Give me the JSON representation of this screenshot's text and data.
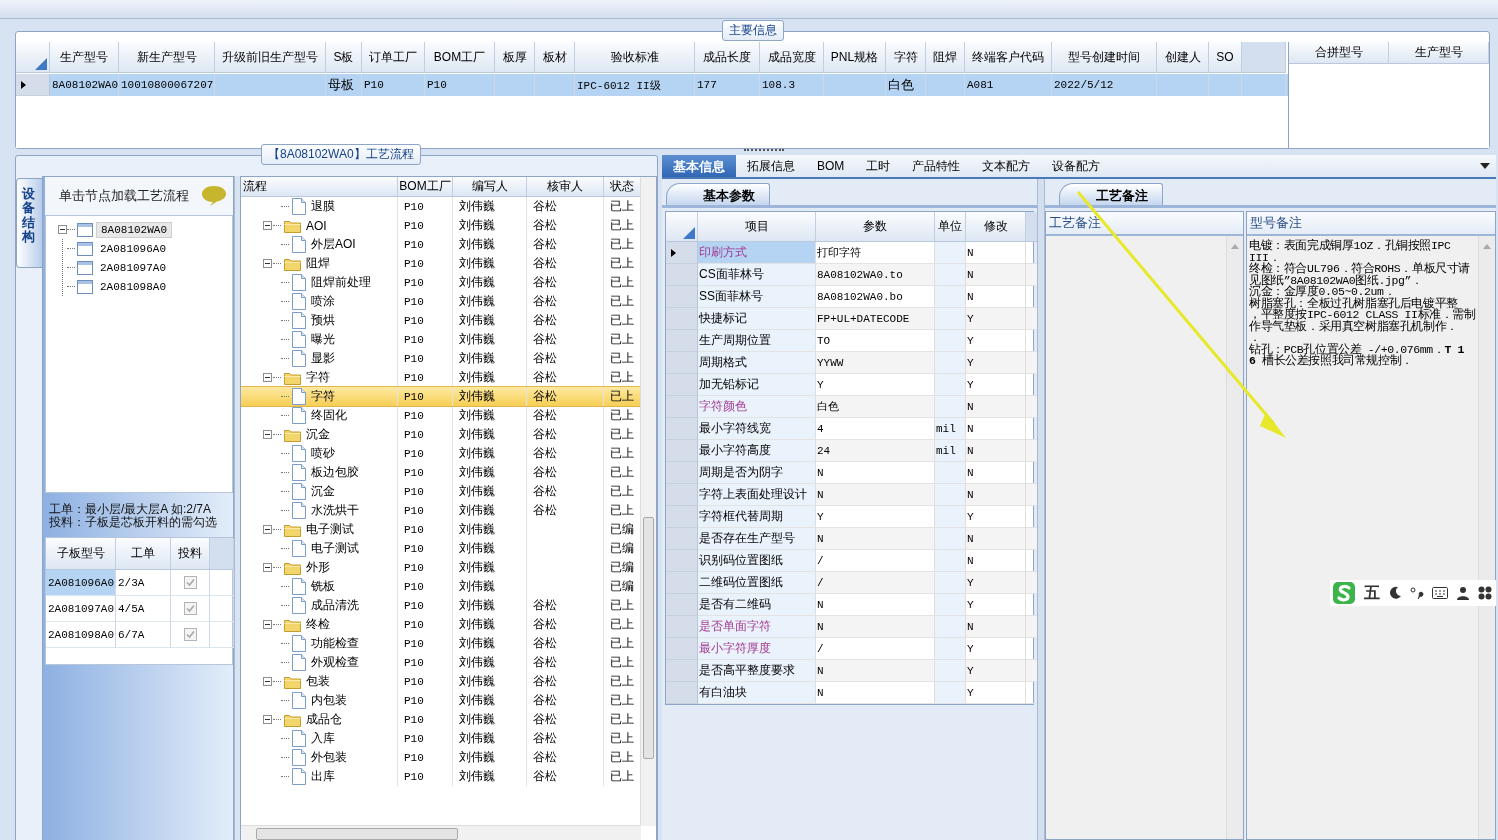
{
  "main_info": {
    "legend": "主要信息",
    "columns": [
      "生产型号",
      "新生产型号",
      "升级前旧生产型号",
      "S板",
      "订单工厂",
      "BOM工厂",
      "板厚",
      "板材",
      "验收标准",
      "成品长度",
      "成品宽度",
      "PNL规格",
      "字符",
      "阻焊",
      "终端客户代码",
      "型号创建时间",
      "创建人",
      "SO"
    ],
    "rows": [
      {
        "selected": true,
        "cells": [
          "8A08102WA0",
          "10010800067207",
          null,
          "母板",
          "P10",
          "P10",
          null,
          null,
          "IPC-6012 II级",
          "177",
          "108.3",
          null,
          "白色",
          null,
          "A081",
          "2022/5/12",
          null,
          null
        ]
      }
    ]
  },
  "merge_grid": {
    "columns": [
      "合拼型号",
      "生产型号"
    ]
  },
  "process_panel": {
    "legend": "【8A08102WA0】工艺流程",
    "side_tab": {
      "label": "设备结构",
      "selected": true
    },
    "structure": {
      "hint": "单击节点加载工艺流程",
      "tree": [
        {
          "label": "8A08102WA0",
          "expanded": true,
          "selected": true,
          "children": [
            {
              "label": "2A081096A0",
              "selected": false
            },
            {
              "label": "2A081097A0",
              "selected": false
            },
            {
              "label": "2A081098A0",
              "selected": false
            }
          ]
        }
      ]
    },
    "notes": [
      "工单：最小层/最大层A 如:2/7A",
      "投料：子板是芯板开料的需勾选"
    ],
    "sub_boards": {
      "columns": [
        "子板型号",
        "工单",
        "投料"
      ],
      "rows": [
        {
          "board": "2A081096A0",
          "order": "2/3A",
          "checked": true,
          "selected": true
        },
        {
          "board": "2A081097A0",
          "order": "4/5A",
          "checked": true,
          "selected": false
        },
        {
          "board": "2A081098A0",
          "order": "6/7A",
          "checked": true,
          "selected": false
        }
      ]
    },
    "flow": {
      "columns": [
        "流程",
        "BOM工厂",
        "编写人",
        "核审人",
        "状态"
      ],
      "rows": [
        {
          "name": "退膜",
          "factory": "P10",
          "writer": "刘伟巍",
          "reviewer": "谷松",
          "status": "已上",
          "selected": false
        },
        {
          "name": "AOI",
          "factory": "P10",
          "writer": "刘伟巍",
          "reviewer": "谷松",
          "status": "已上",
          "selected": false,
          "expanded": true,
          "children": [
            {
              "name": "外层AOI",
              "factory": "P10",
              "writer": "刘伟巍",
              "reviewer": "谷松",
              "status": "已上",
              "selected": false
            }
          ]
        },
        {
          "name": "阻焊",
          "factory": "P10",
          "writer": "刘伟巍",
          "reviewer": "谷松",
          "status": "已上",
          "selected": false,
          "expanded": true,
          "children": [
            {
              "name": "阻焊前处理",
              "factory": "P10",
              "writer": "刘伟巍",
              "reviewer": "谷松",
              "status": "已上",
              "selected": false
            },
            {
              "name": "喷涂",
              "factory": "P10",
              "writer": "刘伟巍",
              "reviewer": "谷松",
              "status": "已上",
              "selected": false
            },
            {
              "name": "预烘",
              "factory": "P10",
              "writer": "刘伟巍",
              "reviewer": "谷松",
              "status": "已上",
              "selected": false
            },
            {
              "name": "曝光",
              "factory": "P10",
              "writer": "刘伟巍",
              "reviewer": "谷松",
              "status": "已上",
              "selected": false
            },
            {
              "name": "显影",
              "factory": "P10",
              "writer": "刘伟巍",
              "reviewer": "谷松",
              "status": "已上",
              "selected": false
            }
          ]
        },
        {
          "name": "字符",
          "factory": "P10",
          "writer": "刘伟巍",
          "reviewer": "谷松",
          "status": "已上",
          "selected": false,
          "expanded": true,
          "children": [
            {
              "name": "字符",
              "factory": "P10",
              "writer": "刘伟巍",
              "reviewer": "谷松",
              "status": "已上",
              "selected": true
            },
            {
              "name": "终固化",
              "factory": "P10",
              "writer": "刘伟巍",
              "reviewer": "谷松",
              "status": "已上",
              "selected": false
            }
          ]
        },
        {
          "name": "沉金",
          "factory": "P10",
          "writer": "刘伟巍",
          "reviewer": "谷松",
          "status": "已上",
          "selected": false,
          "expanded": true,
          "children": [
            {
              "name": "喷砂",
              "factory": "P10",
              "writer": "刘伟巍",
              "reviewer": "谷松",
              "status": "已上",
              "selected": false
            },
            {
              "name": "板边包胶",
              "factory": "P10",
              "writer": "刘伟巍",
              "reviewer": "谷松",
              "status": "已上",
              "selected": false
            },
            {
              "name": "沉金",
              "factory": "P10",
              "writer": "刘伟巍",
              "reviewer": "谷松",
              "status": "已上",
              "selected": false
            },
            {
              "name": "水洗烘干",
              "factory": "P10",
              "writer": "刘伟巍",
              "reviewer": "谷松",
              "status": "已上",
              "selected": false
            }
          ]
        },
        {
          "name": "电子测试",
          "factory": "P10",
          "writer": "刘伟巍",
          "status": "已编",
          "selected": false,
          "expanded": true,
          "children": [
            {
              "name": "电子测试",
              "factory": "P10",
              "writer": "刘伟巍",
              "status": "已编",
              "selected": false
            }
          ]
        },
        {
          "name": "外形",
          "factory": "P10",
          "writer": "刘伟巍",
          "status": "已编",
          "selected": false,
          "expanded": true,
          "children": [
            {
              "name": "铣板",
              "factory": "P10",
              "writer": "刘伟巍",
              "status": "已编",
              "selected": false
            },
            {
              "name": "成品清洗",
              "factory": "P10",
              "writer": "刘伟巍",
              "reviewer": "谷松",
              "status": "已上",
              "selected": false
            }
          ]
        },
        {
          "name": "终检",
          "factory": "P10",
          "writer": "刘伟巍",
          "reviewer": "谷松",
          "status": "已上",
          "selected": false,
          "expanded": true,
          "children": [
            {
              "name": "功能检查",
              "factory": "P10",
              "writer": "刘伟巍",
              "reviewer": "谷松",
              "status": "已上",
              "selected": false
            },
            {
              "name": "外观检查",
              "factory": "P10",
              "writer": "刘伟巍",
              "reviewer": "谷松",
              "status": "已上",
              "selected": false
            }
          ]
        },
        {
          "name": "包装",
          "factory": "P10",
          "writer": "刘伟巍",
          "reviewer": "谷松",
          "status": "已上",
          "selected": false,
          "expanded": true,
          "children": [
            {
              "name": "内包装",
              "factory": "P10",
              "writer": "刘伟巍",
              "reviewer": "谷松",
              "status": "已上",
              "selected": false
            }
          ]
        },
        {
          "name": "成品仓",
          "factory": "P10",
          "writer": "刘伟巍",
          "reviewer": "谷松",
          "status": "已上",
          "selected": false,
          "expanded": true,
          "children": [
            {
              "name": "入库",
              "factory": "P10",
              "writer": "刘伟巍",
              "reviewer": "谷松",
              "status": "已上",
              "selected": false
            },
            {
              "name": "外包装",
              "factory": "P10",
              "writer": "刘伟巍",
              "reviewer": "谷松",
              "status": "已上",
              "selected": false
            },
            {
              "name": "出库",
              "factory": "P10",
              "writer": "刘伟巍",
              "reviewer": "谷松",
              "status": "已上",
              "selected": false
            }
          ]
        }
      ]
    }
  },
  "detail": {
    "tabs": [
      {
        "label": "基本信息",
        "selected": true
      },
      {
        "label": "拓展信息",
        "selected": false
      },
      {
        "label": "BOM",
        "selected": false
      },
      {
        "label": "工时",
        "selected": false
      },
      {
        "label": "产品特性",
        "selected": false
      },
      {
        "label": "文本配方",
        "selected": false
      },
      {
        "label": "设备配方",
        "selected": false
      }
    ],
    "basic": {
      "tab": {
        "label": "基本参数",
        "selected": true
      },
      "columns": [
        "项目",
        "参数",
        "单位",
        "修改"
      ],
      "rows": [
        {
          "item": "印刷方式",
          "value": "打印字符",
          "modified": "N",
          "highlighted": true,
          "selected": true
        },
        {
          "item": "CS面菲林号",
          "value": "8A08102WA0.to",
          "modified": "N",
          "highlighted": false,
          "selected": false
        },
        {
          "item": "SS面菲林号",
          "value": "8A08102WA0.bo",
          "modified": "N",
          "highlighted": false,
          "selected": false
        },
        {
          "item": "快捷标记",
          "value": "FP+UL+DATECODE",
          "modified": "Y",
          "highlighted": false,
          "selected": false
        },
        {
          "item": "生产周期位置",
          "value": "TO",
          "modified": "Y",
          "highlighted": false,
          "selected": false
        },
        {
          "item": "周期格式",
          "value": "YYWW",
          "modified": "Y",
          "highlighted": false,
          "selected": false
        },
        {
          "item": "加无铅标记",
          "value": "Y",
          "modified": "Y",
          "highlighted": false,
          "selected": false
        },
        {
          "item": "字符颜色",
          "value": "白色",
          "modified": "N",
          "highlighted": true,
          "selected": false
        },
        {
          "item": "最小字符线宽",
          "value": "4",
          "unit": "mil",
          "modified": "N",
          "highlighted": false,
          "selected": false
        },
        {
          "item": "最小字符高度",
          "value": "24",
          "unit": "mil",
          "modified": "N",
          "highlighted": false,
          "selected": false
        },
        {
          "item": "周期是否为阴字",
          "value": "N",
          "modified": "N",
          "highlighted": false,
          "selected": false
        },
        {
          "item": "字符上表面处理设计",
          "value": "N",
          "modified": "N",
          "highlighted": false,
          "selected": false
        },
        {
          "item": "字符框代替周期",
          "value": "Y",
          "modified": "Y",
          "highlighted": false,
          "selected": false
        },
        {
          "item": "是否存在生产型号",
          "value": "N",
          "modified": "N",
          "highlighted": false,
          "selected": false
        },
        {
          "item": "识别码位置图纸",
          "value": "/",
          "modified": "N",
          "highlighted": false,
          "selected": false
        },
        {
          "item": "二维码位置图纸",
          "value": "/",
          "modified": "Y",
          "highlighted": false,
          "selected": false
        },
        {
          "item": "是否有二维码",
          "value": "N",
          "modified": "Y",
          "highlighted": false,
          "selected": false
        },
        {
          "item": "是否单面字符",
          "value": "N",
          "modified": "N",
          "highlighted": true,
          "selected": false
        },
        {
          "item": "最小字符厚度",
          "value": "/",
          "modified": "Y",
          "highlighted": true,
          "selected": false
        },
        {
          "item": "是否高平整度要求",
          "value": "N",
          "modified": "Y",
          "highlighted": false,
          "selected": false
        },
        {
          "item": "有白油块",
          "value": "N",
          "modified": "Y",
          "highlighted": false,
          "selected": false
        }
      ]
    },
    "remarks": {
      "tab": {
        "label": "工艺备注",
        "selected": true
      },
      "process_header": "工艺备注",
      "model_header": "型号备注",
      "model_lines": [
        "电镀：表面完成铜厚1OZ．孔铜按照IPC",
        "III．",
        "终检：符合UL796．符合ROHS．单板尺寸请",
        "见图纸”8A08102WA0图纸.jpg”．",
        "沉金：金厚度0.05~0.2um．",
        "树脂塞孔：全板过孔树脂塞孔后电镀平整",
        "，平整度按IPC-6012 CLASS II标准．需制",
        "作导气垫板．采用真空树脂塞孔机制作．",
        "．",
        "钻孔：PCB孔位置公差  -/+0.076mm．**T 1**",
        "**6** 槽长公差按照我司常规控制．"
      ]
    }
  },
  "ime_toolbar": {
    "mode": "五"
  }
}
